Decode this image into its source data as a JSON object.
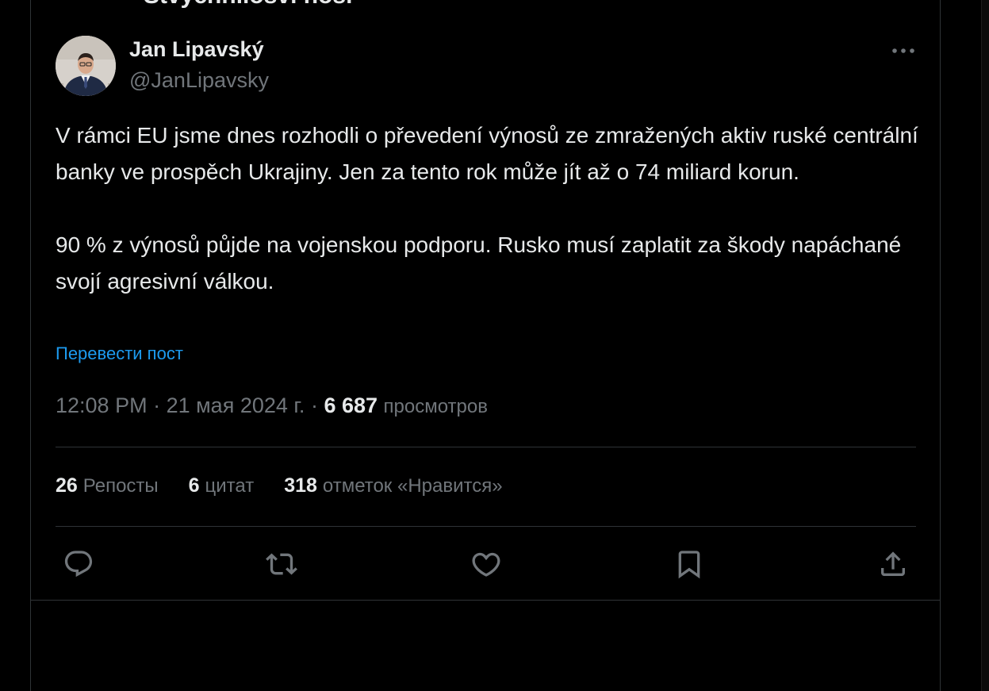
{
  "header": {
    "cut_heading": "Stvýchnilosvi hosi"
  },
  "author": {
    "name": "Jan Lipavský",
    "handle": "@JanLipavsky"
  },
  "tweet": {
    "paragraph_1": "V rámci EU jsme dnes rozhodli o převedení výnosů ze zmražených aktiv ruské centrální banky ve prospěch Ukrajiny. Jen za tento rok může jít až o 74 miliard korun.",
    "paragraph_2": "90 % z výnosů půjde na vojenskou podporu. Rusko musí zaplatit za škody napáchané svojí agresivní válkou.",
    "translate_label": "Перевести пост"
  },
  "meta": {
    "time": "12:08 PM",
    "separator": " · ",
    "date": "21 мая 2024 г.",
    "views_count": "6 687",
    "views_label": "просмотров"
  },
  "stats": {
    "reposts_count": "26",
    "reposts_label": "Репосты",
    "quotes_count": "6",
    "quotes_label": "цитат",
    "likes_count": "318",
    "likes_label": "отметок «Нравится»"
  },
  "icons": {
    "more": "more-horizontal-icon",
    "reply": "reply-icon",
    "repost": "repost-icon",
    "like": "like-icon",
    "bookmark": "bookmark-icon",
    "share": "share-icon"
  },
  "colors": {
    "background": "#000000",
    "text_primary": "#e7e9ea",
    "text_secondary": "#71767b",
    "link": "#1d9bf0",
    "border": "#2f3336"
  }
}
